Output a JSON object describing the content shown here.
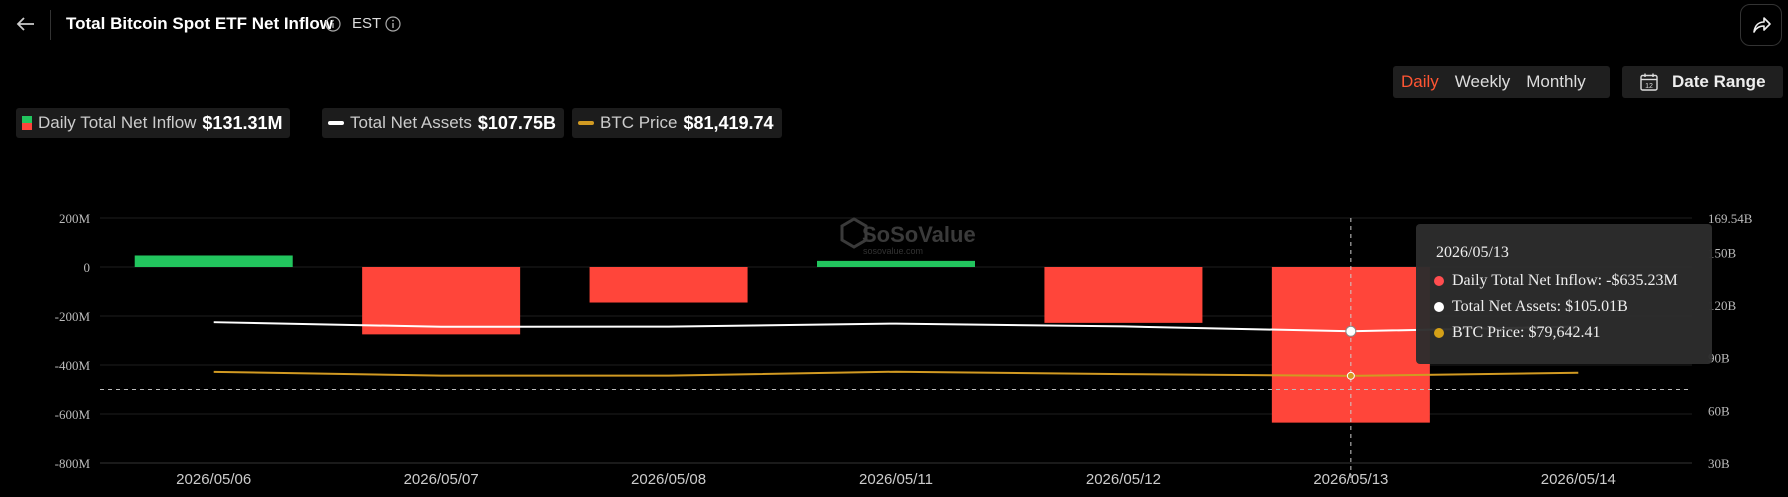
{
  "header": {
    "title": "Total Bitcoin Spot ETF Net Inflow",
    "timezone": "EST"
  },
  "period_tabs": [
    {
      "label": "Daily",
      "active": true
    },
    {
      "label": "Weekly",
      "active": false
    },
    {
      "label": "Monthly",
      "active": false
    }
  ],
  "date_range": {
    "label": "Date Range",
    "calendar_day": "12"
  },
  "legend": [
    {
      "label": "Daily Total Net Inflow",
      "value": "$131.31M"
    },
    {
      "label": "Total Net Assets",
      "value": "$107.75B"
    },
    {
      "label": "BTC Price",
      "value": "$81,419.74"
    }
  ],
  "watermark": {
    "name": "SoSoValue",
    "site": "sosovalue.com"
  },
  "tooltip": {
    "date": "2026/05/13",
    "rows": [
      {
        "label": "Daily Total Net Inflow: -$635.23M",
        "color": "#ff4d4f"
      },
      {
        "label": "Total Net Assets: $105.01B",
        "color": "#ffffff"
      },
      {
        "label": "BTC Price: $79,642.41",
        "color": "#d4a017"
      }
    ]
  },
  "colors": {
    "positive": "#22c55e",
    "negative": "#ff453a",
    "assets_line": "#ffffff",
    "btc_line": "#d19a22"
  },
  "chart_data": {
    "type": "bar",
    "categories": [
      "2026/05/06",
      "2026/05/07",
      "2026/05/08",
      "2026/05/11",
      "2026/05/12",
      "2026/05/13",
      "2026/05/14"
    ],
    "series": [
      {
        "name": "Daily Total Net Inflow",
        "type": "bar",
        "unit": "M",
        "values": [
          47,
          -275,
          -145,
          25,
          -228,
          -635.23,
          null
        ]
      },
      {
        "name": "Total Net Assets",
        "type": "line",
        "unit": "B",
        "values": [
          110.2,
          107.6,
          107.7,
          109.4,
          107.8,
          105.01,
          107.75
        ]
      },
      {
        "name": "BTC Price",
        "type": "line",
        "values": [
          81900,
          79800,
          79750,
          82000,
          80600,
          79642.41,
          81419.74
        ]
      }
    ],
    "left_axis": {
      "ticks": [
        "200M",
        "0",
        "-200M",
        "-400M",
        "-600M",
        "-800M"
      ],
      "tick_values": [
        200,
        0,
        -200,
        -400,
        -600,
        -800
      ],
      "ylim": [
        -800,
        200
      ]
    },
    "right_axis": {
      "ticks": [
        "169.54B",
        "150B",
        "120B",
        "90B",
        "60B",
        "30B"
      ],
      "tick_values": [
        169.54,
        150,
        120,
        90,
        60,
        30
      ],
      "ylim": [
        30,
        169.54
      ]
    },
    "btc_axis_hidden_range": [
      30000,
      169540
    ],
    "reference_line": -500,
    "highlighted_index": 5
  }
}
